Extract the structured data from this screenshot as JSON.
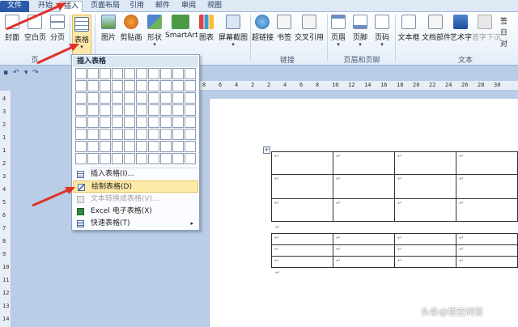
{
  "tabs": [
    "文件",
    "开始",
    "插入",
    "页面布局",
    "引用",
    "邮件",
    "审阅",
    "视图"
  ],
  "ribbon": {
    "page_buttons": [
      "封面",
      "空白页",
      "分页"
    ],
    "table_button": "表格",
    "illustration_buttons": [
      "图片",
      "剪贴画",
      "形状",
      "SmartArt",
      "图表",
      "屏幕截图"
    ],
    "link_buttons": [
      "超链接",
      "书签",
      "交叉引用"
    ],
    "header_buttons": [
      "页眉",
      "页脚",
      "页码"
    ],
    "text_buttons": [
      "文本框",
      "文档部件",
      "艺术字",
      "首字下沉"
    ],
    "right_small": [
      "签",
      "日",
      "对"
    ],
    "group_labels": {
      "pages": "页",
      "links": "链接",
      "header_footer": "页眉和页脚",
      "text": "文本"
    }
  },
  "dropdown": {
    "title": "插入表格",
    "items": [
      {
        "label": "插入表格(I)...",
        "state": "normal",
        "icon": "table-icon"
      },
      {
        "label": "绘制表格(D)",
        "state": "highlighted",
        "icon": "pencil-icon"
      },
      {
        "label": "文本转换成表格(V)...",
        "state": "disabled",
        "icon": "convert-icon"
      },
      {
        "label": "Excel 电子表格(X)",
        "state": "normal",
        "icon": "excel-icon"
      },
      {
        "label": "快速表格(T)",
        "state": "normal",
        "icon": "quick-table-icon",
        "submenu_arrow": "▸"
      }
    ]
  },
  "ruler_numbers": [
    "8",
    "6",
    "4",
    "2",
    "2",
    "4",
    "6",
    "8",
    "10",
    "12",
    "14",
    "16",
    "18",
    "20",
    "22",
    "24",
    "26",
    "28",
    "30"
  ],
  "vruler_numbers": [
    "4",
    "3",
    "2",
    "1",
    "1",
    "2",
    "3",
    "4",
    "5",
    "6",
    "7",
    "8",
    "9",
    "10",
    "11",
    "12",
    "13",
    "14"
  ],
  "para_mark": "↵",
  "watermark": "头条@悟空问答",
  "colors": {
    "accent_arrow": "#e0312b",
    "highlight": "#fde9a8",
    "file_tab": "#2a5aa8"
  }
}
